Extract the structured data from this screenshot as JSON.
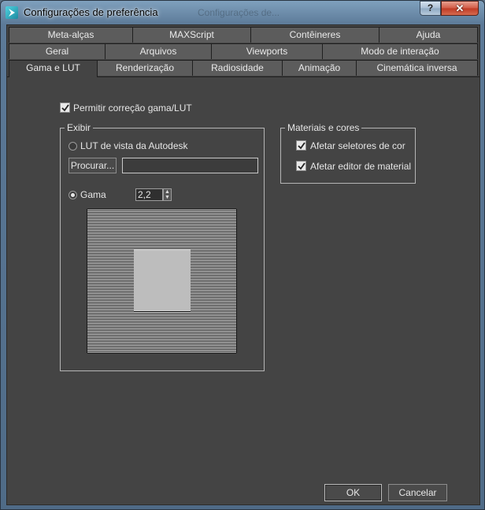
{
  "window": {
    "title": "Configurações de preferência",
    "background_title": "Configurações de...",
    "help_label": "?",
    "close_label": "✕"
  },
  "tabs": {
    "row1": [
      "Meta-alças",
      "MAXScript",
      "Contêineres",
      "Ajuda"
    ],
    "row2": [
      "Geral",
      "Arquivos",
      "Viewports",
      "Modo de interação"
    ],
    "row3": [
      "Gama e LUT",
      "Renderização",
      "Radiosidade",
      "Animação",
      "Cinemática inversa"
    ],
    "active": "Gama e LUT"
  },
  "gamma": {
    "enable_label": "Permitir correção gama/LUT",
    "enable_checked": true
  },
  "display_group": {
    "title": "Exibir",
    "lut_label": "LUT de vista da Autodesk",
    "lut_selected": false,
    "browse_label": "Procurar...",
    "lut_path": "",
    "gamma_label": "Gama",
    "gamma_selected": true,
    "gamma_value": "2,2"
  },
  "materials_group": {
    "title": "Materiais e cores",
    "affect_color_label": "Afetar seletores de cor",
    "affect_color_checked": true,
    "affect_material_label": "Afetar editor de material",
    "affect_material_checked": true
  },
  "footer": {
    "ok_label": "OK",
    "cancel_label": "Cancelar"
  },
  "icons": {
    "app": "3dsmax-logo-icon",
    "check": "checkmark-icon"
  }
}
